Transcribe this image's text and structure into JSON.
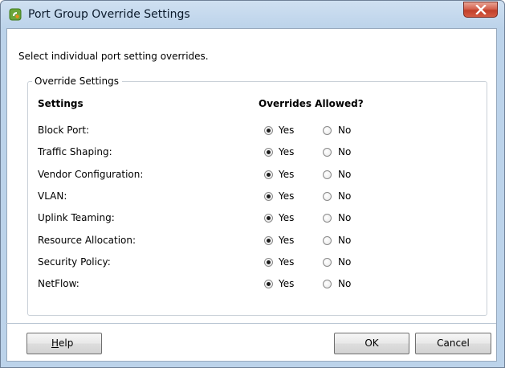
{
  "window": {
    "title": "Port Group Override Settings"
  },
  "instruction": "Select individual port setting overrides.",
  "group": {
    "legend": "Override Settings",
    "col_settings": "Settings",
    "col_overrides": "Overrides Allowed?",
    "yes_label": "Yes",
    "no_label": "No",
    "rows": [
      {
        "label": "Block Port:",
        "value": "Yes"
      },
      {
        "label": "Traffic Shaping:",
        "value": "Yes"
      },
      {
        "label": "Vendor Configuration:",
        "value": "Yes"
      },
      {
        "label": "VLAN:",
        "value": "Yes"
      },
      {
        "label": "Uplink Teaming:",
        "value": "Yes"
      },
      {
        "label": "Resource Allocation:",
        "value": "Yes"
      },
      {
        "label": "Security Policy:",
        "value": "Yes"
      },
      {
        "label": "NetFlow:",
        "value": "Yes"
      }
    ]
  },
  "buttons": {
    "help_mnemonic": "H",
    "help_rest": "elp",
    "ok": "OK",
    "cancel": "Cancel"
  },
  "colors": {
    "titlebar": "#bcd3ea",
    "close_button": "#c1402a",
    "icon_green": "#6aa53a",
    "icon_orange": "#e98a1c"
  },
  "icons": {
    "app": "vsphere-icon",
    "close": "close-icon"
  }
}
